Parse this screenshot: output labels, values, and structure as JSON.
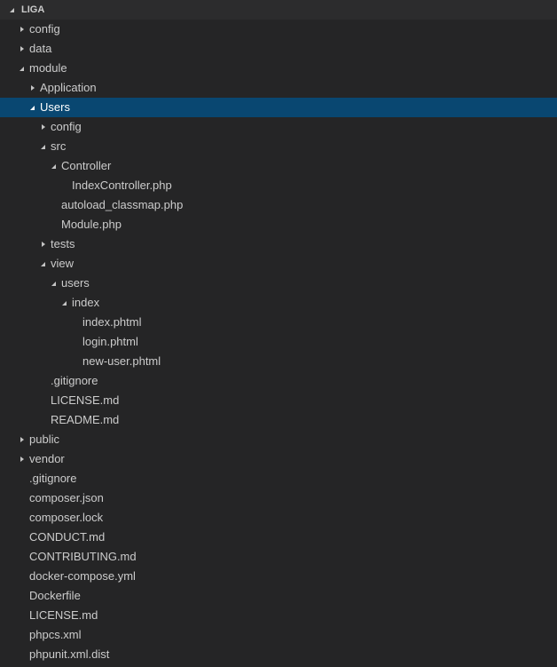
{
  "explorer": {
    "section_title": "LIGA",
    "colors": {
      "background": "#252526",
      "selection": "#094771",
      "text": "#cccccc"
    },
    "tree": [
      {
        "label": "config",
        "type": "folder",
        "expanded": false
      },
      {
        "label": "data",
        "type": "folder",
        "expanded": false
      },
      {
        "label": "module",
        "type": "folder",
        "expanded": true
      },
      {
        "label": "Application",
        "type": "folder",
        "expanded": false
      },
      {
        "label": "Users",
        "type": "folder",
        "expanded": true,
        "selected": true
      },
      {
        "label": "config",
        "type": "folder",
        "expanded": false
      },
      {
        "label": "src",
        "type": "folder",
        "expanded": true
      },
      {
        "label": "Controller",
        "type": "folder",
        "expanded": true
      },
      {
        "label": "IndexController.php",
        "type": "file"
      },
      {
        "label": "autoload_classmap.php",
        "type": "file"
      },
      {
        "label": "Module.php",
        "type": "file"
      },
      {
        "label": "tests",
        "type": "folder",
        "expanded": false
      },
      {
        "label": "view",
        "type": "folder",
        "expanded": true
      },
      {
        "label": "users",
        "type": "folder",
        "expanded": true
      },
      {
        "label": "index",
        "type": "folder",
        "expanded": true
      },
      {
        "label": "index.phtml",
        "type": "file"
      },
      {
        "label": "login.phtml",
        "type": "file"
      },
      {
        "label": "new-user.phtml",
        "type": "file"
      },
      {
        "label": ".gitignore",
        "type": "file"
      },
      {
        "label": "LICENSE.md",
        "type": "file"
      },
      {
        "label": "README.md",
        "type": "file"
      },
      {
        "label": "public",
        "type": "folder",
        "expanded": false
      },
      {
        "label": "vendor",
        "type": "folder",
        "expanded": false
      },
      {
        "label": ".gitignore",
        "type": "file"
      },
      {
        "label": "composer.json",
        "type": "file"
      },
      {
        "label": "composer.lock",
        "type": "file"
      },
      {
        "label": "CONDUCT.md",
        "type": "file"
      },
      {
        "label": "CONTRIBUTING.md",
        "type": "file"
      },
      {
        "label": "docker-compose.yml",
        "type": "file"
      },
      {
        "label": "Dockerfile",
        "type": "file"
      },
      {
        "label": "LICENSE.md",
        "type": "file"
      },
      {
        "label": "phpcs.xml",
        "type": "file"
      },
      {
        "label": "phpunit.xml.dist",
        "type": "file"
      }
    ]
  }
}
